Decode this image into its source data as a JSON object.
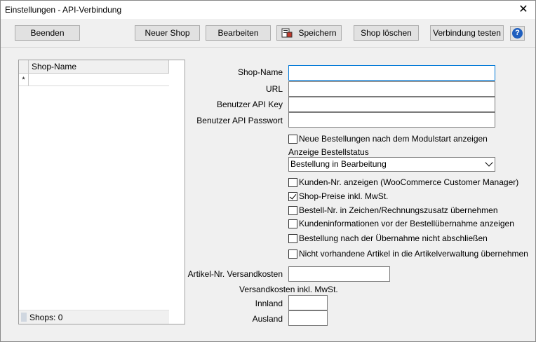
{
  "window": {
    "title": "Einstellungen - API-Verbindung"
  },
  "toolbar": {
    "beenden": "Beenden",
    "neuer_shop": "Neuer Shop",
    "bearbeiten": "Bearbeiten",
    "speichern": "Speichern",
    "shop_loeschen": "Shop löschen",
    "verbindung_testen": "Verbindung testen",
    "help": "?"
  },
  "grid": {
    "column_header": "Shop-Name",
    "new_row_marker": "*",
    "footer": "Shops: 0"
  },
  "form": {
    "shop_name": {
      "label": "Shop-Name",
      "value": ""
    },
    "url": {
      "label": "URL",
      "value": ""
    },
    "api_key": {
      "label": "Benutzer API Key",
      "value": ""
    },
    "api_password": {
      "label": "Benutzer API Passwort",
      "value": ""
    },
    "neue_bestellungen": {
      "label": "Neue Bestellungen nach dem Modulstart anzeigen",
      "checked": false
    },
    "anzeige_bestellstatus": {
      "label": "Anzeige Bestellstatus",
      "selected": "Bestellung in Bearbeitung"
    },
    "kunden_nr": {
      "label": "Kunden-Nr. anzeigen (WooCommerce Customer Manager)",
      "checked": false
    },
    "shop_preise": {
      "label": "Shop-Preise inkl. MwSt.",
      "checked": true
    },
    "bestell_nr": {
      "label": "Bestell-Nr. in Zeichen/Rechnungszusatz übernehmen",
      "checked": false
    },
    "kundeninfo": {
      "label": "Kundeninformationen vor der Bestellübernahme anzeigen",
      "checked": false
    },
    "nicht_abschliessen": {
      "label": "Bestellung nach der Übernahme nicht abschließen",
      "checked": false
    },
    "nicht_vorhandene": {
      "label": "Nicht vorhandene Artikel in die Artikelverwaltung übernehmen",
      "checked": false
    },
    "artikel_nr_versandkosten": {
      "label": "Artikel-Nr. Versandkosten",
      "value": ""
    },
    "versandkosten_header": "Versandkosten inkl. MwSt.",
    "inland": {
      "label": "Innland",
      "value": ""
    },
    "ausland": {
      "label": "Ausland",
      "value": ""
    }
  }
}
